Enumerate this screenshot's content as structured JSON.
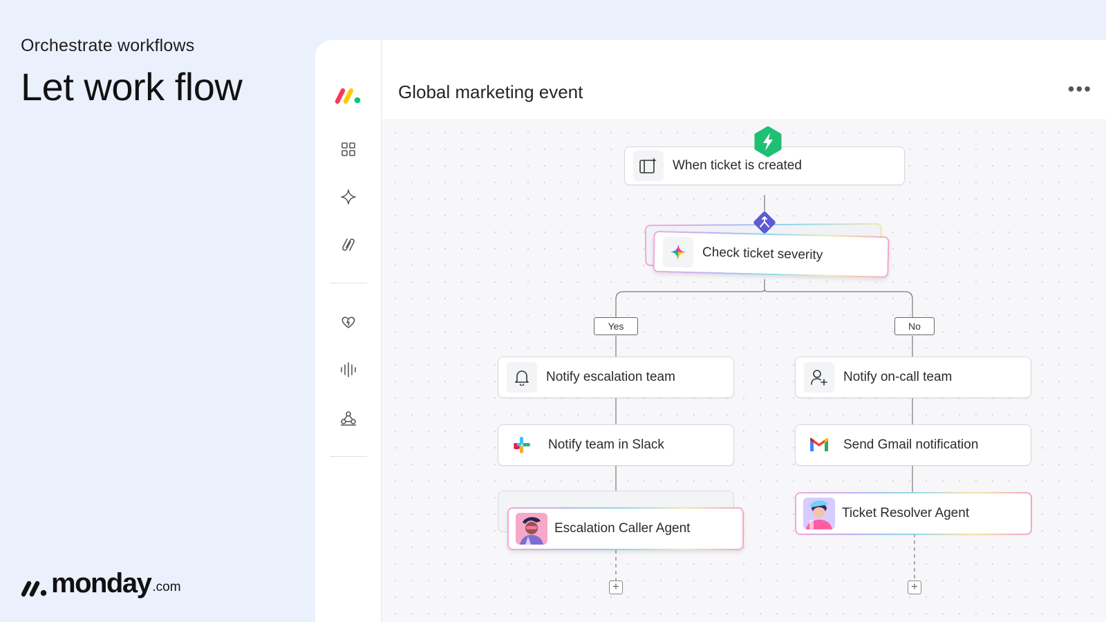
{
  "hero": {
    "eyebrow": "Orchestrate workflows",
    "headline": "Let work flow"
  },
  "brand": {
    "word": "monday",
    "tld": ".com"
  },
  "board": {
    "title": "Global marketing event",
    "more_icon": "more-horizontal-icon"
  },
  "sidebar": {
    "items": [
      {
        "icon": "monday-logo-icon"
      },
      {
        "icon": "grid-icon"
      },
      {
        "icon": "sparkle-icon"
      },
      {
        "icon": "integration-icon"
      },
      {
        "icon": "heart-icon"
      },
      {
        "icon": "audio-wave-icon"
      },
      {
        "icon": "network-icon"
      }
    ]
  },
  "workflow": {
    "trigger": {
      "label": "When ticket is created",
      "icon": "board-sparkle-icon",
      "badge_icon": "lightning-icon"
    },
    "condition": {
      "label": "Check ticket severity",
      "icon": "ai-sparkle-icon",
      "badge_icon": "branch-icon"
    },
    "branches": {
      "yes": {
        "tag": "Yes",
        "steps": [
          {
            "label": "Notify escalation team",
            "icon": "bell-icon"
          },
          {
            "label": "Notify team in Slack",
            "icon": "slack-icon"
          },
          {
            "label": "Escalation Caller Agent",
            "icon": "agent-avatar"
          }
        ]
      },
      "no": {
        "tag": "No",
        "steps": [
          {
            "label": "Notify on-call team",
            "icon": "user-plus-icon"
          },
          {
            "label": "Send Gmail notification",
            "icon": "gmail-icon"
          },
          {
            "label": "Ticket Resolver Agent",
            "icon": "agent-avatar"
          }
        ]
      }
    },
    "add_step_icon": "plus-icon"
  },
  "colors": {
    "page_bg": "#ebf0fd",
    "trigger_badge": "#1fbf75",
    "condition_badge": "#5b5bd6",
    "monday_red": "#f53b57",
    "monday_yellow": "#ffcb00",
    "monday_green": "#00ca72"
  }
}
